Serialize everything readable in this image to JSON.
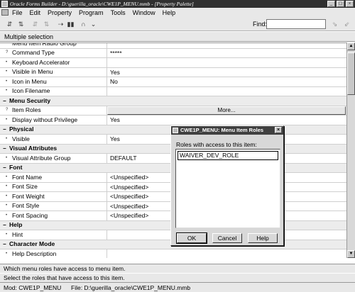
{
  "window": {
    "title": "Oracle Forms Builder - D:\\guerilla_oracle\\CWE1P_MENU.mmb - [Property Palette]",
    "min_label": "_",
    "max_label": "□",
    "close_label": "×"
  },
  "menu": [
    "File",
    "Edit",
    "Property",
    "Program",
    "Tools",
    "Window",
    "Help"
  ],
  "toolbar": {
    "find_label": "Find:",
    "find_value": ""
  },
  "selection_label": "Multiple selection",
  "properties": [
    {
      "type": "prop",
      "bullet": "•",
      "name": "Menu Item Radio Group",
      "value": ""
    },
    {
      "type": "prop",
      "bullet": "?",
      "name": "Command Type",
      "value": "*****"
    },
    {
      "type": "prop",
      "bullet": "•",
      "name": "Keyboard Accelerator",
      "value": ""
    },
    {
      "type": "prop",
      "bullet": "•",
      "name": "Visible in Menu",
      "value": "Yes"
    },
    {
      "type": "prop",
      "bullet": "•",
      "name": "Icon in Menu",
      "value": "No"
    },
    {
      "type": "prop",
      "bullet": "•",
      "name": "Icon Filename",
      "value": ""
    },
    {
      "type": "cat",
      "bullet": "−",
      "name": "Menu Security"
    },
    {
      "type": "button",
      "bullet": "?",
      "name": "Item Roles",
      "value": "More..."
    },
    {
      "type": "prop",
      "bullet": "•",
      "name": "Display without Privilege",
      "value": "Yes"
    },
    {
      "type": "cat",
      "bullet": "−",
      "name": "Physical"
    },
    {
      "type": "prop",
      "bullet": "•",
      "name": "Visible",
      "value": "Yes"
    },
    {
      "type": "cat",
      "bullet": "−",
      "name": "Visual Attributes"
    },
    {
      "type": "prop",
      "bullet": "•",
      "name": "Visual Attribute Group",
      "value": "DEFAULT"
    },
    {
      "type": "cat",
      "bullet": "−",
      "name": "Font"
    },
    {
      "type": "prop",
      "bullet": "•",
      "name": "Font Name",
      "value": "<Unspecified>"
    },
    {
      "type": "prop",
      "bullet": "•",
      "name": "Font Size",
      "value": "<Unspecified>"
    },
    {
      "type": "prop",
      "bullet": "•",
      "name": "Font Weight",
      "value": "<Unspecified>"
    },
    {
      "type": "prop",
      "bullet": "•",
      "name": "Font Style",
      "value": "<Unspecified>"
    },
    {
      "type": "prop",
      "bullet": "•",
      "name": "Font Spacing",
      "value": "<Unspecified>"
    },
    {
      "type": "cat",
      "bullet": "−",
      "name": "Help"
    },
    {
      "type": "prop",
      "bullet": "•",
      "name": "Hint",
      "value": ""
    },
    {
      "type": "cat",
      "bullet": "−",
      "name": "Character Mode"
    },
    {
      "type": "prop",
      "bullet": "•",
      "name": "Help Description",
      "value": ""
    }
  ],
  "hint_text": "Which menu roles have access to menu item.",
  "status": {
    "line1": "Select the roles that have access to this item.",
    "mod": "Mod: CWE1P_MENU",
    "file": "File: D:\\guerilla_oracle\\CWE1P_MENU.mmb"
  },
  "dialog": {
    "title": "CWE1P_MENU: Menu Item Roles",
    "label": "Roles with access to this item:",
    "roles": [
      "WAIVER_DEV_ROLE"
    ],
    "ok": "OK",
    "cancel": "Cancel",
    "help": "Help",
    "close_label": "×"
  }
}
